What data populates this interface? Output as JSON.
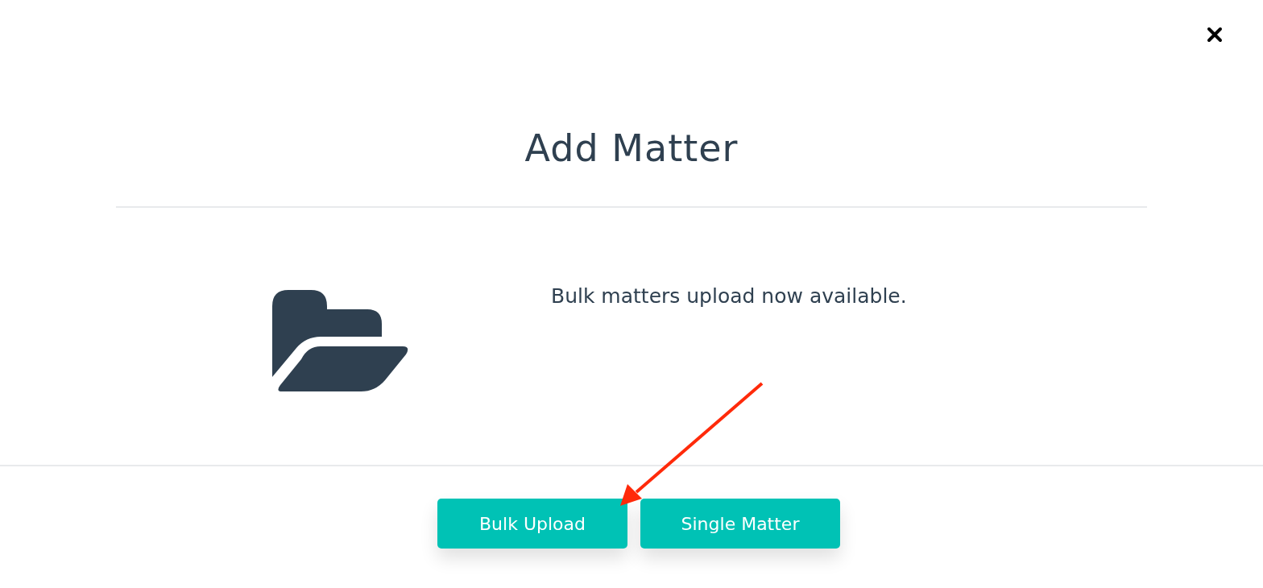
{
  "dialog": {
    "title": "Add Matter",
    "message": "Bulk matters upload now available.",
    "buttons": [
      {
        "label": "Bulk Upload"
      },
      {
        "label": "Single Matter"
      }
    ]
  }
}
